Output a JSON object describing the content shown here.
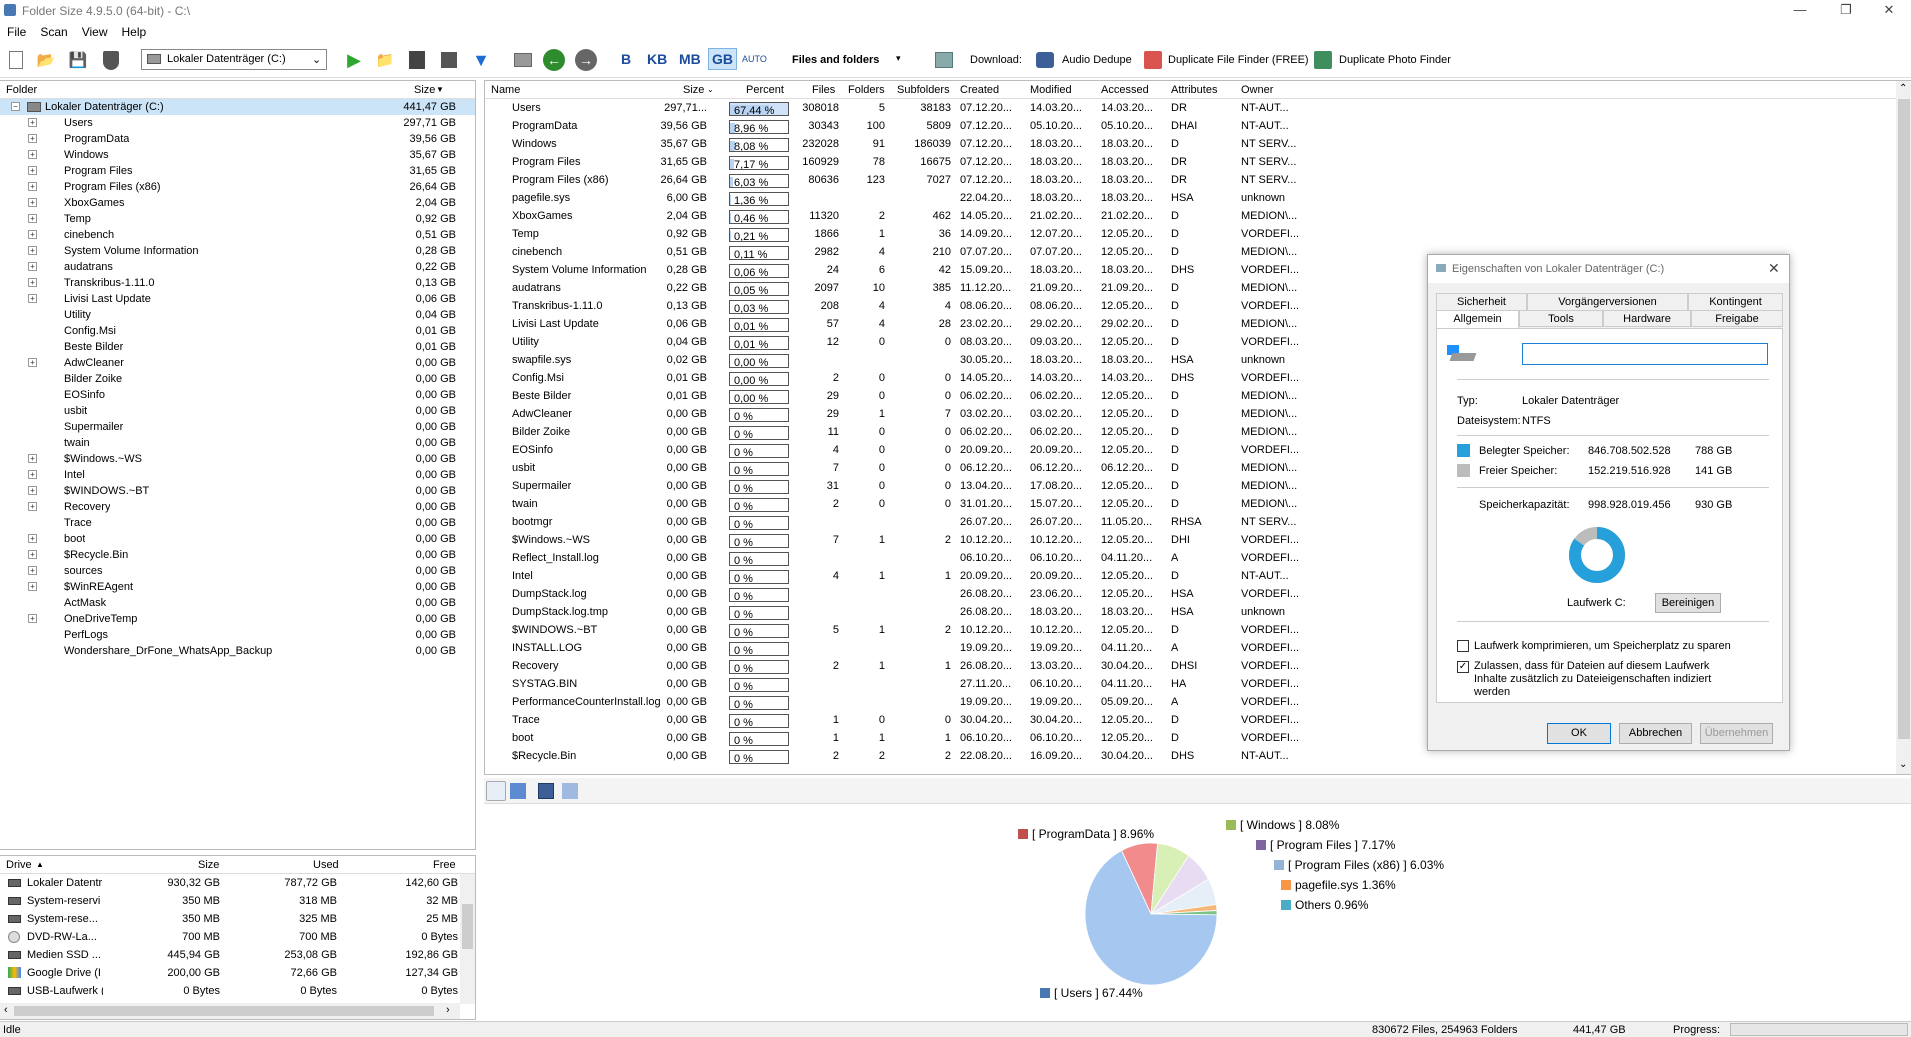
{
  "window": {
    "title": "Folder Size 4.9.5.0 (64-bit) - C:\\"
  },
  "menu": [
    "File",
    "Scan",
    "View",
    "Help"
  ],
  "toolbar": {
    "drive_select": "Lokaler Datenträger (C:)",
    "units": [
      "B",
      "KB",
      "MB",
      "GB",
      "AUTO"
    ],
    "view_mode": "Files and folders",
    "download_label": "Download:",
    "links": [
      "Audio Dedupe",
      "Duplicate File Finder (FREE)",
      "Duplicate Photo Finder"
    ]
  },
  "tree": {
    "headers": {
      "folder": "Folder",
      "size": "Size"
    },
    "root": {
      "name": "Lokaler Datenträger (C:)",
      "size": "441,47 GB"
    },
    "items": [
      {
        "name": "Users",
        "size": "297,71 GB",
        "exp": true
      },
      {
        "name": "ProgramData",
        "size": "39,56 GB",
        "exp": true
      },
      {
        "name": "Windows",
        "size": "35,67 GB",
        "exp": true
      },
      {
        "name": "Program Files",
        "size": "31,65 GB",
        "exp": true
      },
      {
        "name": "Program Files (x86)",
        "size": "26,64 GB",
        "exp": true
      },
      {
        "name": "XboxGames",
        "size": "2,04 GB",
        "exp": true
      },
      {
        "name": "Temp",
        "size": "0,92 GB",
        "exp": true
      },
      {
        "name": "cinebench",
        "size": "0,51 GB",
        "exp": true
      },
      {
        "name": "System Volume Information",
        "size": "0,28 GB",
        "exp": true
      },
      {
        "name": "audatrans",
        "size": "0,22 GB",
        "exp": true
      },
      {
        "name": "Transkribus-1.11.0",
        "size": "0,13 GB",
        "exp": true
      },
      {
        "name": "Livisi Last Update",
        "size": "0,06 GB",
        "exp": true
      },
      {
        "name": "Utility",
        "size": "0,04 GB",
        "exp": false
      },
      {
        "name": "Config.Msi",
        "size": "0,01 GB",
        "exp": false
      },
      {
        "name": "Beste Bilder",
        "size": "0,01 GB",
        "exp": false
      },
      {
        "name": "AdwCleaner",
        "size": "0,00 GB",
        "exp": true
      },
      {
        "name": "Bilder Zoike",
        "size": "0,00 GB",
        "exp": false
      },
      {
        "name": "EOSinfo",
        "size": "0,00 GB",
        "exp": false
      },
      {
        "name": "usbit",
        "size": "0,00 GB",
        "exp": false
      },
      {
        "name": "Supermailer",
        "size": "0,00 GB",
        "exp": false
      },
      {
        "name": "twain",
        "size": "0,00 GB",
        "exp": false
      },
      {
        "name": "$Windows.~WS",
        "size": "0,00 GB",
        "exp": true
      },
      {
        "name": "Intel",
        "size": "0,00 GB",
        "exp": true
      },
      {
        "name": "$WINDOWS.~BT",
        "size": "0,00 GB",
        "exp": true
      },
      {
        "name": "Recovery",
        "size": "0,00 GB",
        "exp": true
      },
      {
        "name": "Trace",
        "size": "0,00 GB",
        "exp": false
      },
      {
        "name": "boot",
        "size": "0,00 GB",
        "exp": true
      },
      {
        "name": "$Recycle.Bin",
        "size": "0,00 GB",
        "exp": true
      },
      {
        "name": "sources",
        "size": "0,00 GB",
        "exp": true
      },
      {
        "name": "$WinREAgent",
        "size": "0,00 GB",
        "exp": true
      },
      {
        "name": "ActMask",
        "size": "0,00 GB",
        "exp": false
      },
      {
        "name": "OneDriveTemp",
        "size": "0,00 GB",
        "exp": true
      },
      {
        "name": "PerfLogs",
        "size": "0,00 GB",
        "exp": false
      },
      {
        "name": "Wondershare_DrFone_WhatsApp_Backup",
        "size": "0,00 GB",
        "exp": false
      }
    ]
  },
  "drives": {
    "headers": [
      "Drive",
      "Size",
      "Used",
      "Free"
    ],
    "rows": [
      {
        "name": "Lokaler Datentr",
        "size": "930,32 GB",
        "used": "787,72 GB",
        "free": "142,60 GB",
        "icon": "drive"
      },
      {
        "name": "System-reservi",
        "size": "350 MB",
        "used": "318 MB",
        "free": "32 MB",
        "icon": "drive"
      },
      {
        "name": "System-rese...",
        "size": "350 MB",
        "used": "325 MB",
        "free": "25 MB",
        "icon": "drive"
      },
      {
        "name": "DVD-RW-La...",
        "size": "700 MB",
        "used": "700 MB",
        "free": "0 Bytes",
        "icon": "disc"
      },
      {
        "name": "Medien SSD ...",
        "size": "445,94 GB",
        "used": "253,08 GB",
        "free": "192,86 GB",
        "icon": "drive"
      },
      {
        "name": "Google Drive (I",
        "size": "200,00 GB",
        "used": "72,66 GB",
        "free": "127,34 GB",
        "icon": "gdrive"
      },
      {
        "name": "USB-Laufwerk (",
        "size": "0 Bytes",
        "used": "0 Bytes",
        "free": "0 Bytes",
        "icon": "drive"
      }
    ]
  },
  "files": {
    "headers": [
      "Name",
      "Size",
      "Percent",
      "Files",
      "Folders",
      "Subfolders",
      "Created",
      "Modified",
      "Accessed",
      "Attributes",
      "Owner"
    ],
    "rows": [
      {
        "n": "Users",
        "s": "297,71...",
        "p": "67,44 %",
        "pv": 67.44,
        "f": "308018",
        "fo": "5",
        "sf": "38183",
        "c": "07.12.20...",
        "m": "14.03.20...",
        "a": "14.03.20...",
        "at": "DR",
        "o": "NT-AUT...",
        "t": "d"
      },
      {
        "n": "ProgramData",
        "s": "39,56 GB",
        "p": "8,96 %",
        "pv": 8.96,
        "f": "30343",
        "fo": "100",
        "sf": "5809",
        "c": "07.12.20...",
        "m": "05.10.20...",
        "a": "05.10.20...",
        "at": "DHAI",
        "o": "NT-AUT...",
        "t": "d"
      },
      {
        "n": "Windows",
        "s": "35,67 GB",
        "p": "8,08 %",
        "pv": 8.08,
        "f": "232028",
        "fo": "91",
        "sf": "186039",
        "c": "07.12.20...",
        "m": "18.03.20...",
        "a": "18.03.20...",
        "at": "D",
        "o": "NT SERV...",
        "t": "d"
      },
      {
        "n": "Program Files",
        "s": "31,65 GB",
        "p": "7,17 %",
        "pv": 7.17,
        "f": "160929",
        "fo": "78",
        "sf": "16675",
        "c": "07.12.20...",
        "m": "18.03.20...",
        "a": "18.03.20...",
        "at": "DR",
        "o": "NT SERV...",
        "t": "d"
      },
      {
        "n": "Program Files (x86)",
        "s": "26,64 GB",
        "p": "6,03 %",
        "pv": 6.03,
        "f": "80636",
        "fo": "123",
        "sf": "7027",
        "c": "07.12.20...",
        "m": "18.03.20...",
        "a": "18.03.20...",
        "at": "DR",
        "o": "NT SERV...",
        "t": "d"
      },
      {
        "n": "pagefile.sys",
        "s": "6,00 GB",
        "p": "1,36 %",
        "pv": 1.36,
        "f": "",
        "fo": "",
        "sf": "",
        "c": "22.04.20...",
        "m": "18.03.20...",
        "a": "18.03.20...",
        "at": "HSA",
        "o": "unknown",
        "t": "s"
      },
      {
        "n": "XboxGames",
        "s": "2,04 GB",
        "p": "0,46 %",
        "pv": 0.46,
        "f": "11320",
        "fo": "2",
        "sf": "462",
        "c": "14.05.20...",
        "m": "21.02.20...",
        "a": "21.02.20...",
        "at": "D",
        "o": "MEDION\\...",
        "t": "d"
      },
      {
        "n": "Temp",
        "s": "0,92 GB",
        "p": "0,21 %",
        "pv": 0.21,
        "f": "1866",
        "fo": "1",
        "sf": "36",
        "c": "14.09.20...",
        "m": "12.07.20...",
        "a": "12.05.20...",
        "at": "D",
        "o": "VORDEFI...",
        "t": "d"
      },
      {
        "n": "cinebench",
        "s": "0,51 GB",
        "p": "0,11 %",
        "pv": 0.11,
        "f": "2982",
        "fo": "4",
        "sf": "210",
        "c": "07.07.20...",
        "m": "07.07.20...",
        "a": "12.05.20...",
        "at": "D",
        "o": "MEDION\\...",
        "t": "d"
      },
      {
        "n": "System Volume Information",
        "s": "0,28 GB",
        "p": "0,06 %",
        "pv": 0.06,
        "f": "24",
        "fo": "6",
        "sf": "42",
        "c": "15.09.20...",
        "m": "18.03.20...",
        "a": "18.03.20...",
        "at": "DHS",
        "o": "VORDEFI...",
        "t": "d"
      },
      {
        "n": "audatrans",
        "s": "0,22 GB",
        "p": "0,05 %",
        "pv": 0.05,
        "f": "2097",
        "fo": "10",
        "sf": "385",
        "c": "11.12.20...",
        "m": "21.09.20...",
        "a": "21.09.20...",
        "at": "D",
        "o": "MEDION\\...",
        "t": "d"
      },
      {
        "n": "Transkribus-1.11.0",
        "s": "0,13 GB",
        "p": "0,03 %",
        "pv": 0.03,
        "f": "208",
        "fo": "4",
        "sf": "4",
        "c": "08.06.20...",
        "m": "08.06.20...",
        "a": "12.05.20...",
        "at": "D",
        "o": "VORDEFI...",
        "t": "d"
      },
      {
        "n": "Livisi Last Update",
        "s": "0,06 GB",
        "p": "0,01 %",
        "pv": 0.01,
        "f": "57",
        "fo": "4",
        "sf": "28",
        "c": "23.02.20...",
        "m": "29.02.20...",
        "a": "29.02.20...",
        "at": "D",
        "o": "MEDION\\...",
        "t": "d"
      },
      {
        "n": "Utility",
        "s": "0,04 GB",
        "p": "0,01 %",
        "pv": 0.01,
        "f": "12",
        "fo": "0",
        "sf": "0",
        "c": "08.03.20...",
        "m": "09.03.20...",
        "a": "12.05.20...",
        "at": "D",
        "o": "VORDEFI...",
        "t": "d"
      },
      {
        "n": "swapfile.sys",
        "s": "0,02 GB",
        "p": "0,00 %",
        "pv": 0,
        "f": "",
        "fo": "",
        "sf": "",
        "c": "30.05.20...",
        "m": "18.03.20...",
        "a": "18.03.20...",
        "at": "HSA",
        "o": "unknown",
        "t": "s"
      },
      {
        "n": "Config.Msi",
        "s": "0,01 GB",
        "p": "0,00 %",
        "pv": 0,
        "f": "2",
        "fo": "0",
        "sf": "0",
        "c": "14.05.20...",
        "m": "14.03.20...",
        "a": "14.03.20...",
        "at": "DHS",
        "o": "VORDEFI...",
        "t": "d"
      },
      {
        "n": "Beste Bilder",
        "s": "0,01 GB",
        "p": "0,00 %",
        "pv": 0,
        "f": "29",
        "fo": "0",
        "sf": "0",
        "c": "06.02.20...",
        "m": "06.02.20...",
        "a": "12.05.20...",
        "at": "D",
        "o": "MEDION\\...",
        "t": "d"
      },
      {
        "n": "AdwCleaner",
        "s": "0,00 GB",
        "p": "0 %",
        "pv": 0,
        "f": "29",
        "fo": "1",
        "sf": "7",
        "c": "03.02.20...",
        "m": "03.02.20...",
        "a": "12.05.20...",
        "at": "D",
        "o": "MEDION\\...",
        "t": "d"
      },
      {
        "n": "Bilder Zoike",
        "s": "0,00 GB",
        "p": "0 %",
        "pv": 0,
        "f": "11",
        "fo": "0",
        "sf": "0",
        "c": "06.02.20...",
        "m": "06.02.20...",
        "a": "12.05.20...",
        "at": "D",
        "o": "MEDION\\...",
        "t": "d"
      },
      {
        "n": "EOSinfo",
        "s": "0,00 GB",
        "p": "0 %",
        "pv": 0,
        "f": "4",
        "fo": "0",
        "sf": "0",
        "c": "20.09.20...",
        "m": "20.09.20...",
        "a": "12.05.20...",
        "at": "D",
        "o": "VORDEFI...",
        "t": "d"
      },
      {
        "n": "usbit",
        "s": "0,00 GB",
        "p": "0 %",
        "pv": 0,
        "f": "7",
        "fo": "0",
        "sf": "0",
        "c": "06.12.20...",
        "m": "06.12.20...",
        "a": "06.12.20...",
        "at": "D",
        "o": "MEDION\\...",
        "t": "d"
      },
      {
        "n": "Supermailer",
        "s": "0,00 GB",
        "p": "0 %",
        "pv": 0,
        "f": "31",
        "fo": "0",
        "sf": "0",
        "c": "13.04.20...",
        "m": "17.08.20...",
        "a": "12.05.20...",
        "at": "D",
        "o": "MEDION\\...",
        "t": "d"
      },
      {
        "n": "twain",
        "s": "0,00 GB",
        "p": "0 %",
        "pv": 0,
        "f": "2",
        "fo": "0",
        "sf": "0",
        "c": "31.01.20...",
        "m": "15.07.20...",
        "a": "12.05.20...",
        "at": "D",
        "o": "MEDION\\...",
        "t": "d"
      },
      {
        "n": "bootmgr",
        "s": "0,00 GB",
        "p": "0 %",
        "pv": 0,
        "f": "",
        "fo": "",
        "sf": "",
        "c": "26.07.20...",
        "m": "26.07.20...",
        "a": "11.05.20...",
        "at": "RHSA",
        "o": "NT SERV...",
        "t": "s"
      },
      {
        "n": "$Windows.~WS",
        "s": "0,00 GB",
        "p": "0 %",
        "pv": 0,
        "f": "7",
        "fo": "1",
        "sf": "2",
        "c": "10.12.20...",
        "m": "10.12.20...",
        "a": "12.05.20...",
        "at": "DHI",
        "o": "VORDEFI...",
        "t": "d"
      },
      {
        "n": "Reflect_Install.log",
        "s": "0,00 GB",
        "p": "0 %",
        "pv": 0,
        "f": "",
        "fo": "",
        "sf": "",
        "c": "06.10.20...",
        "m": "06.10.20...",
        "a": "04.11.20...",
        "at": "A",
        "o": "VORDEFI...",
        "t": "f"
      },
      {
        "n": "Intel",
        "s": "0,00 GB",
        "p": "0 %",
        "pv": 0,
        "f": "4",
        "fo": "1",
        "sf": "1",
        "c": "20.09.20...",
        "m": "20.09.20...",
        "a": "12.05.20...",
        "at": "D",
        "o": "NT-AUT...",
        "t": "d"
      },
      {
        "n": "DumpStack.log",
        "s": "0,00 GB",
        "p": "0 %",
        "pv": 0,
        "f": "",
        "fo": "",
        "sf": "",
        "c": "26.08.20...",
        "m": "23.06.20...",
        "a": "12.05.20...",
        "at": "HSA",
        "o": "VORDEFI...",
        "t": "f"
      },
      {
        "n": "DumpStack.log.tmp",
        "s": "0,00 GB",
        "p": "0 %",
        "pv": 0,
        "f": "",
        "fo": "",
        "sf": "",
        "c": "26.08.20...",
        "m": "18.03.20...",
        "a": "18.03.20...",
        "at": "HSA",
        "o": "unknown",
        "t": "f"
      },
      {
        "n": "$WINDOWS.~BT",
        "s": "0,00 GB",
        "p": "0 %",
        "pv": 0,
        "f": "5",
        "fo": "1",
        "sf": "2",
        "c": "10.12.20...",
        "m": "10.12.20...",
        "a": "12.05.20...",
        "at": "D",
        "o": "VORDEFI...",
        "t": "d"
      },
      {
        "n": "INSTALL.LOG",
        "s": "0,00 GB",
        "p": "0 %",
        "pv": 0,
        "f": "",
        "fo": "",
        "sf": "",
        "c": "19.09.20...",
        "m": "19.09.20...",
        "a": "04.11.20...",
        "at": "A",
        "o": "VORDEFI...",
        "t": "f"
      },
      {
        "n": "Recovery",
        "s": "0,00 GB",
        "p": "0 %",
        "pv": 0,
        "f": "2",
        "fo": "1",
        "sf": "1",
        "c": "26.08.20...",
        "m": "13.03.20...",
        "a": "30.04.20...",
        "at": "DHSI",
        "o": "VORDEFI...",
        "t": "d"
      },
      {
        "n": "SYSTAG.BIN",
        "s": "0,00 GB",
        "p": "0 %",
        "pv": 0,
        "f": "",
        "fo": "",
        "sf": "",
        "c": "27.11.20...",
        "m": "06.10.20...",
        "a": "04.11.20...",
        "at": "HA",
        "o": "VORDEFI...",
        "t": "f"
      },
      {
        "n": "PerformanceCounterInstall.log",
        "s": "0,00 GB",
        "p": "0 %",
        "pv": 0,
        "f": "",
        "fo": "",
        "sf": "",
        "c": "19.09.20...",
        "m": "19.09.20...",
        "a": "05.09.20...",
        "at": "A",
        "o": "VORDEFI...",
        "t": "f"
      },
      {
        "n": "Trace",
        "s": "0,00 GB",
        "p": "0 %",
        "pv": 0,
        "f": "1",
        "fo": "0",
        "sf": "0",
        "c": "30.04.20...",
        "m": "30.04.20...",
        "a": "12.05.20...",
        "at": "D",
        "o": "VORDEFI...",
        "t": "d"
      },
      {
        "n": "boot",
        "s": "0,00 GB",
        "p": "0 %",
        "pv": 0,
        "f": "1",
        "fo": "1",
        "sf": "1",
        "c": "06.10.20...",
        "m": "06.10.20...",
        "a": "12.05.20...",
        "at": "D",
        "o": "VORDEFI...",
        "t": "d"
      },
      {
        "n": "$Recycle.Bin",
        "s": "0,00 GB",
        "p": "0 %",
        "pv": 0,
        "f": "2",
        "fo": "2",
        "sf": "2",
        "c": "22.08.20...",
        "m": "16.09.20...",
        "a": "30.04.20...",
        "at": "DHS",
        "o": "NT-AUT...",
        "t": "d"
      }
    ]
  },
  "chart_data": {
    "type": "pie",
    "title": "",
    "slices": [
      {
        "label": "[ Users ] 67.44%",
        "value": 67.44,
        "color": "#a6c8f0"
      },
      {
        "label": "[ ProgramData ] 8.96%",
        "value": 8.96,
        "color": "#f28c8c"
      },
      {
        "label": "[ Windows ] 8.08%",
        "value": 8.08,
        "color": "#d8efb6"
      },
      {
        "label": "[ Program Files ] 7.17%",
        "value": 7.17,
        "color": "#e7dcf2"
      },
      {
        "label": "[ Program Files (x86) ] 6.03%",
        "value": 6.03,
        "color": "#e6eef8"
      },
      {
        "label": "pagefile.sys 1.36%",
        "value": 1.36,
        "color": "#f4b97a"
      },
      {
        "label": "Others 0.96%",
        "value": 0.96,
        "color": "#7bc489"
      }
    ],
    "legend_colors": {
      "[ Users ] 67.44%": "#4a78b3",
      "[ ProgramData ] 8.96%": "#c0504d",
      "[ Windows ] 8.08%": "#9bbb59",
      "[ Program Files ] 7.17%": "#8064a2",
      "[ Program Files (x86) ] 6.03%": "#95b3d7",
      "pagefile.sys 1.36%": "#f79646",
      "Others 0.96%": "#4bacc6"
    }
  },
  "dialog": {
    "title": "Eigenschaften von Lokaler Datenträger (C:)",
    "tabs_row1": [
      "Sicherheit",
      "Vorgängerversionen",
      "Kontingent"
    ],
    "tabs_row2": [
      "Allgemein",
      "Tools",
      "Hardware",
      "Freigabe"
    ],
    "name_value": "",
    "typ_label": "Typ:",
    "typ_value": "Lokaler Datenträger",
    "fs_label": "Dateisystem:",
    "fs_value": "NTFS",
    "used_label": "Belegter Speicher:",
    "used_bytes": "846.708.502.528",
    "used_gb": "788 GB",
    "free_label": "Freier Speicher:",
    "free_bytes": "152.219.516.928",
    "free_gb": "141 GB",
    "cap_label": "Speicherkapazität:",
    "cap_bytes": "998.928.019.456",
    "cap_gb": "930 GB",
    "used_fraction": 0.8476,
    "drive_label": "Laufwerk C:",
    "cleanup": "Bereinigen",
    "compress": "Laufwerk komprimieren, um Speicherplatz zu sparen",
    "index": "Zulassen, dass für Dateien auf diesem Laufwerk Inhalte zusätzlich zu Dateieigenschaften indiziert werden",
    "compress_checked": false,
    "index_checked": true,
    "ok": "OK",
    "cancel": "Abbrechen",
    "apply": "Übernehmen"
  },
  "status": {
    "state": "Idle",
    "counts": "830672 Files, 254963 Folders",
    "total": "441,47 GB",
    "progress_label": "Progress:"
  }
}
